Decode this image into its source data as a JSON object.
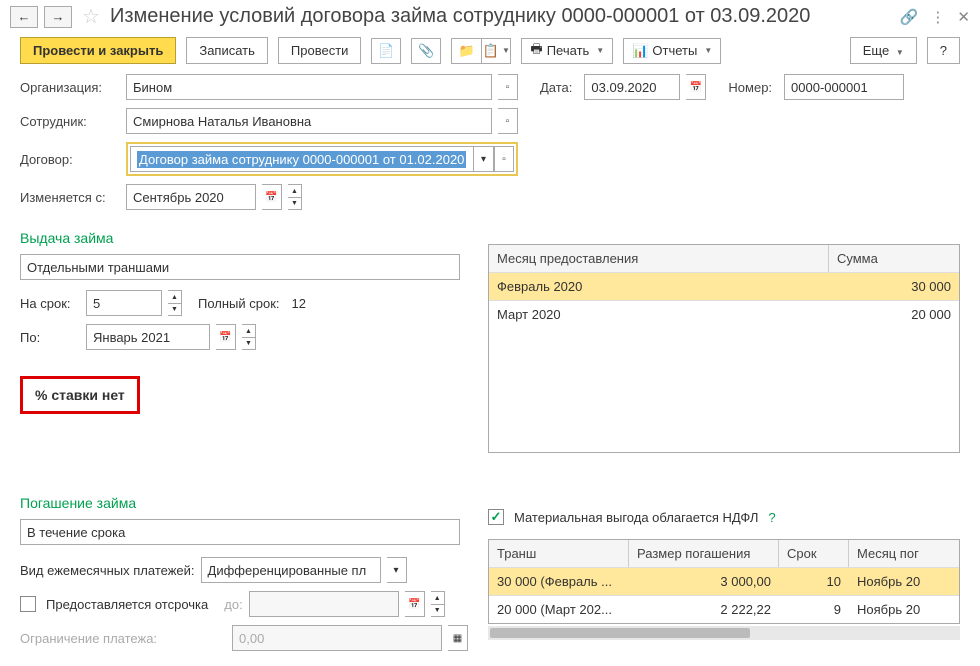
{
  "title": "Изменение условий договора займа сотруднику 0000-000001 от 03.09.2020",
  "toolbar": {
    "submit_close": "Провести и закрыть",
    "save": "Записать",
    "submit": "Провести",
    "print": "Печать",
    "reports": "Отчеты",
    "more": "Еще"
  },
  "fields": {
    "org_label": "Организация:",
    "org_value": "Бином",
    "date_label": "Дата:",
    "date_value": "03.09.2020",
    "number_label": "Номер:",
    "number_value": "0000-000001",
    "employee_label": "Сотрудник:",
    "employee_value": "Смирнова Наталья Ивановна",
    "contract_label": "Договор:",
    "contract_value": "Договор займа сотруднику 0000-000001 от 01.02.2020",
    "changes_from_label": "Изменяется с:",
    "changes_from_value": "Сентябрь 2020"
  },
  "loan": {
    "section": "Выдача займа",
    "method": "Отдельными траншами",
    "term_label": "На срок:",
    "term_value": "5",
    "full_term_label": "Полный срок:",
    "full_term_value": "12",
    "until_label": "По:",
    "until_value": "Январь 2021",
    "no_rate": "% ставки нет"
  },
  "tranches": {
    "col_month": "Месяц предоставления",
    "col_sum": "Сумма",
    "rows": [
      {
        "month": "Февраль 2020",
        "sum": "30 000"
      },
      {
        "month": "Март 2020",
        "sum": "20 000"
      }
    ]
  },
  "repay": {
    "section": "Погашение займа",
    "method": "В течение срока",
    "pay_type_label": "Вид ежемесячных платежей:",
    "pay_type_value": "Дифференцированные пл",
    "benefit_label": "Материальная выгода облагается НДФЛ",
    "deferral_label": "Предоставляется отсрочка",
    "to_label": "до:",
    "limit_label": "Ограничение платежа:",
    "limit_value": "0,00"
  },
  "repay_table": {
    "col_tranche": "Транш",
    "col_amount": "Размер погашения",
    "col_term": "Срок",
    "col_month": "Месяц пог",
    "rows": [
      {
        "tranche": "30 000  (Февраль ...",
        "amount": "3 000,00",
        "term": "10",
        "month": "Ноябрь 20"
      },
      {
        "tranche": "20 000  (Март 202...",
        "amount": "2 222,22",
        "term": "9",
        "month": "Ноябрь 20"
      }
    ]
  }
}
